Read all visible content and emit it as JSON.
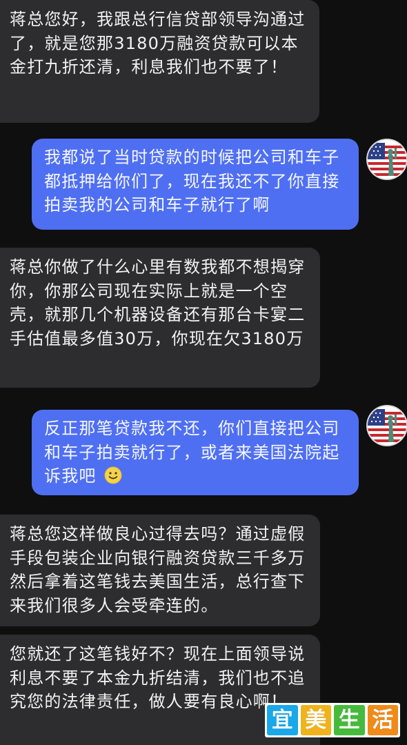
{
  "colors": {
    "background": "#0f0f10",
    "incoming_bubble": "#2d2d2f",
    "outgoing_bubble": "#4f6ff2",
    "incoming_text": "#f2f2f2",
    "outgoing_text": "#f6f8ff",
    "watermark_1": "#19a8ea",
    "watermark_2": "#f0b31b",
    "watermark_3": "#46bb3b",
    "watermark_4": "#f08a18"
  },
  "messages": [
    {
      "direction": "incoming",
      "text": "蒋总您好，我跟总行信贷部领导沟通过了，就是您那3180万融资贷款可以本金打九折还清，利息我们也不要了！"
    },
    {
      "direction": "outgoing",
      "text": "我都说了当时贷款的时候把公司和车子都抵押给你们了，现在我还不了你直接拍卖我的公司和车子就行了啊",
      "avatar_icon": "american-flag-statue-of-liberty-icon"
    },
    {
      "direction": "incoming",
      "text": "蒋总你做了什么心里有数我都不想揭穿你，你那公司现在实际上就是一个空壳，就那几个机器设备还有那台卡宴二手估值最多值30万，你现在欠3180万"
    },
    {
      "direction": "outgoing",
      "text": "反正那笔贷款我不还，你们直接把公司和车子拍卖就行了，或者来美国法院起诉我吧",
      "emoji_icon": "smiling-face-emoji-icon",
      "avatar_icon": "american-flag-statue-of-liberty-icon"
    },
    {
      "direction": "incoming",
      "text": "蒋总您这样做良心过得去吗？通过虚假手段包装企业向银行融资贷款三千多万然后拿着这笔钱去美国生活，总行查下来我们很多人会受牵连的。"
    },
    {
      "direction": "incoming",
      "text": "您就还了这笔钱好不？现在上面领导说利息不要了本金九折结清，我们也不追究您的法律责任，做人要有良心啊！"
    }
  ],
  "watermark": {
    "chars": [
      "宜",
      "美",
      "生",
      "活"
    ]
  }
}
